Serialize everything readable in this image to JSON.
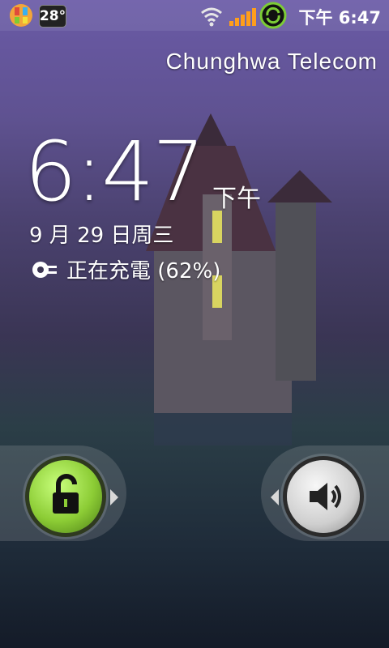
{
  "status_bar": {
    "temperature": "28°",
    "time": "下午 6:47",
    "icons": [
      "app-icon",
      "wifi-icon",
      "signal-icon",
      "sync-icon"
    ]
  },
  "lock_screen": {
    "carrier": "Chunghwa Telecom",
    "clock": "6:47",
    "ampm": "下午",
    "date": "9 月 29 日周三",
    "charging": "正在充電 (62%)"
  },
  "controls": {
    "unlock_icon": "unlock-icon",
    "sound_icon": "speaker-icon"
  },
  "colors": {
    "accent_green": "#8ccc35",
    "bg_top": "#6a5aa6",
    "bg_bottom": "#141b28"
  }
}
